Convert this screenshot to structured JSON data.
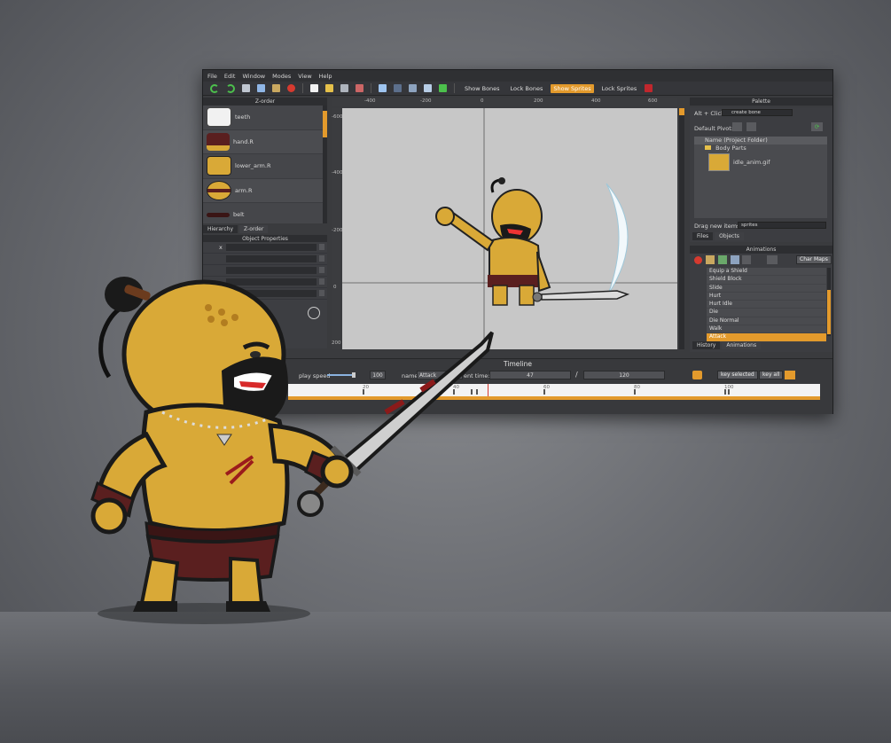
{
  "menu": [
    "File",
    "Edit",
    "Window",
    "Modes",
    "View",
    "Help"
  ],
  "toolbar": {
    "show_bones": "Show Bones",
    "lock_bones": "Lock Bones",
    "show_sprites": "Show Sprites",
    "lock_sprites": "Lock Sprites"
  },
  "zorder": {
    "title": "Z-order",
    "items": [
      "teeth",
      "hand.R",
      "lower_arm.R",
      "arm.R",
      "belt"
    ],
    "tabs": [
      "Hierarchy",
      "Z-order"
    ]
  },
  "object_properties": {
    "title": "Object Properties",
    "x_label": "x"
  },
  "rulers": {
    "top": [
      "-400",
      "-200",
      "0",
      "200",
      "400",
      "600"
    ],
    "left": [
      "-600",
      "-400",
      "-200",
      "0",
      "200"
    ]
  },
  "palette": {
    "title": "Palette",
    "alt_click_label": "Alt + Click:",
    "alt_click_value": "create bone",
    "default_pivot_label": "Default Pivot:",
    "tree_header_name": "Name",
    "tree_header_folder": "(Project Folder)",
    "folder": "Body Parts",
    "file": "idle_anim.gif",
    "drag_label": "Drag new items as:",
    "drag_value": "sprites",
    "tabs": [
      "Files",
      "Objects"
    ]
  },
  "animations": {
    "title": "Animations",
    "char_maps": "Char Maps",
    "items": [
      "Equip a Shield",
      "Shield Block",
      "Slide",
      "Hurt",
      "Hurt Idle",
      "Die",
      "Die Normal",
      "Walk",
      "Attack"
    ],
    "selected_index": 8,
    "tabs": [
      "History",
      "Animations"
    ]
  },
  "timeline": {
    "title": "Timeline",
    "play_speed_label": "play speed",
    "play_speed_value": "100",
    "name_label": "name",
    "name_value": "Attack",
    "current_time_label": "ent time:",
    "current_time": "47",
    "slash": "/",
    "total_time": "120",
    "key_selected": "key selected",
    "key_all": "key all",
    "marks": [
      "20",
      "40",
      "60",
      "80",
      "100"
    ]
  },
  "colors": {
    "accent": "#e39a2c",
    "canvas_bg": "#c7c7c7",
    "skin": "#d9a937"
  }
}
